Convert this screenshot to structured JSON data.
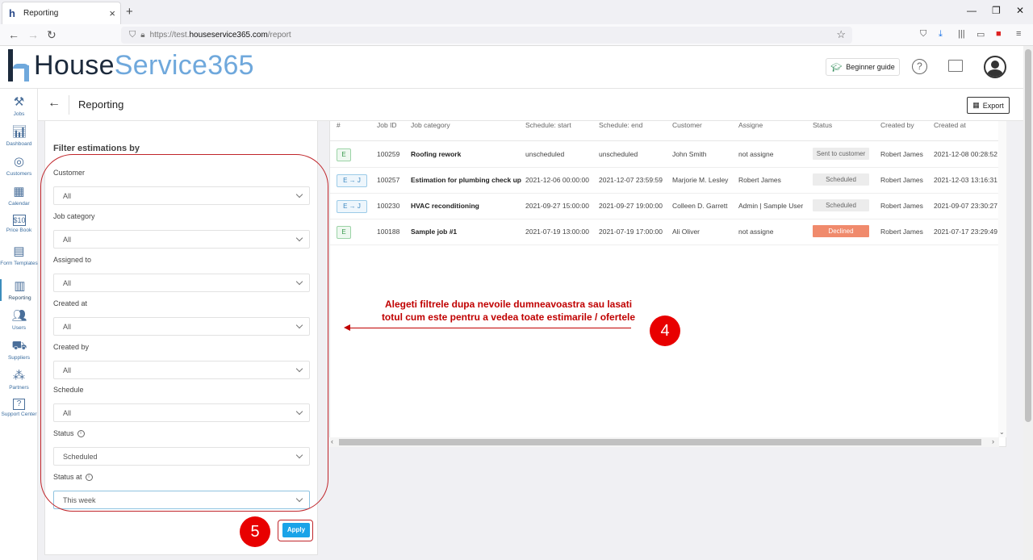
{
  "browser": {
    "tab_title": "Reporting",
    "url_prefix": "https://test.",
    "url_host": "houseservice365.com",
    "url_path": "/report"
  },
  "header": {
    "logo_part1": "House",
    "logo_part2": "Service365",
    "beginner_guide": "Beginner guide"
  },
  "nav": {
    "items": [
      {
        "label": "Jobs",
        "icon": "tools-icon"
      },
      {
        "label": "Dashboard",
        "icon": "bar-chart-icon"
      },
      {
        "label": "Customers",
        "icon": "target-icon"
      },
      {
        "label": "Calendar",
        "icon": "calendar-icon"
      },
      {
        "label": "Price Book",
        "icon": "price-tag-icon"
      },
      {
        "label": "Form Templates",
        "icon": "form-icon"
      },
      {
        "label": "Reporting",
        "icon": "report-icon"
      },
      {
        "label": "Users",
        "icon": "users-icon"
      },
      {
        "label": "Suppliers",
        "icon": "truck-icon"
      },
      {
        "label": "Partners",
        "icon": "partners-icon"
      },
      {
        "label": "Support Center",
        "icon": "help-icon"
      }
    ]
  },
  "page": {
    "title": "Reporting",
    "export_label": "Export"
  },
  "filters": {
    "title": "Filter estimations by",
    "groups": [
      {
        "label": "Customer",
        "value": "All"
      },
      {
        "label": "Job category",
        "value": "All"
      },
      {
        "label": "Assigned to",
        "value": "All"
      },
      {
        "label": "Created at",
        "value": "All"
      },
      {
        "label": "Created by",
        "value": "All"
      },
      {
        "label": "Schedule",
        "value": "All"
      },
      {
        "label": "Status",
        "value": "Scheduled"
      },
      {
        "label": "Status at",
        "value": "This week"
      }
    ],
    "apply_label": "Apply"
  },
  "table": {
    "headers": [
      "#",
      "Job ID",
      "Job category",
      "Schedule: start",
      "Schedule: end",
      "Customer",
      "Assigne",
      "Status",
      "Created by",
      "Created at"
    ],
    "rows": [
      {
        "badge": "E",
        "job_id": "100259",
        "category": "Roofing rework",
        "start": "unscheduled",
        "end": "unscheduled",
        "customer": "John Smith",
        "assignee": "not assigne",
        "status": "Sent to customer",
        "created_by": "Robert James",
        "created_at": "2021-12-08 00:28:52"
      },
      {
        "badge": "E → J",
        "job_id": "100257",
        "category": "Estimation for plumbing check up",
        "start": "2021-12-06 00:00:00",
        "end": "2021-12-07 23:59:59",
        "customer": "Marjorie M. Lesley",
        "assignee": "Robert James",
        "status": "Scheduled",
        "created_by": "Robert James",
        "created_at": "2021-12-03 13:16:31"
      },
      {
        "badge": "E → J",
        "job_id": "100230",
        "category": "HVAC reconditioning",
        "start": "2021-09-27 15:00:00",
        "end": "2021-09-27 19:00:00",
        "customer": "Colleen D. Garrett",
        "assignee": "Admin | Sample User",
        "status": "Scheduled",
        "created_by": "Robert James",
        "created_at": "2021-09-07 23:30:27"
      },
      {
        "badge": "E",
        "job_id": "100188",
        "category": "Sample job #1",
        "start": "2021-07-19 13:00:00",
        "end": "2021-07-19 17:00:00",
        "customer": "Ali Oliver",
        "assignee": "not assigne",
        "status": "Declined",
        "created_by": "Robert James",
        "created_at": "2021-07-17 23:29:49"
      }
    ]
  },
  "annotation": {
    "line1": "Alegeti filtrele dupa nevoile dumneavoastra sau lasati",
    "line2": "totul cum este pentru a vedea toate estimarile / ofertele",
    "step4": "4",
    "step5": "5"
  },
  "colors": {
    "accent": "#1aa3e8",
    "annotation_red": "#c00000",
    "declined": "#f08a6c"
  }
}
